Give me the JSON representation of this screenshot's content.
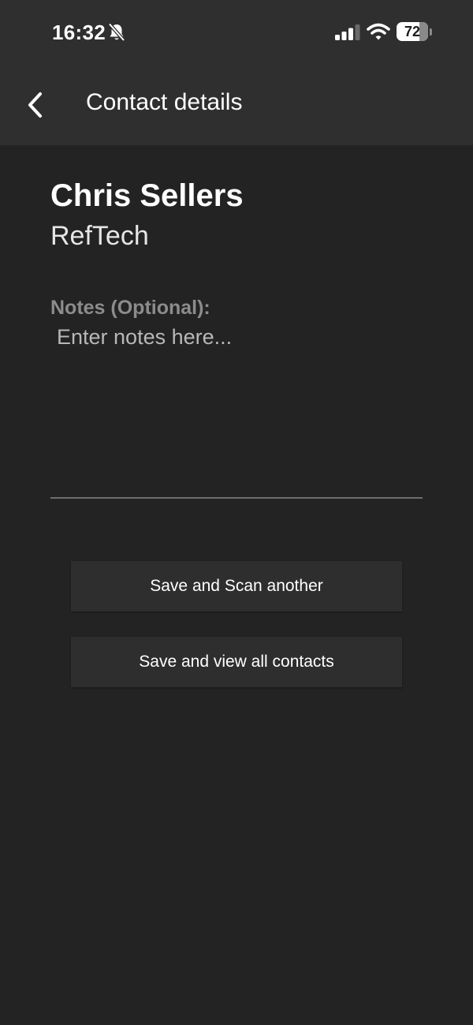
{
  "status_bar": {
    "time": "16:32",
    "battery_level": "72",
    "battery_fraction": 0.72,
    "icons": [
      "bell-slash-icon",
      "cellular-signal-icon",
      "wifi-icon",
      "battery-icon"
    ]
  },
  "header": {
    "back_icon": "chevron-left-icon",
    "title": "Contact details"
  },
  "contact": {
    "name": "Chris Sellers",
    "company": "RefTech"
  },
  "notes": {
    "label": "Notes (Optional):",
    "placeholder": "Enter notes here...",
    "value": ""
  },
  "actions": {
    "save_scan_label": "Save and Scan another",
    "save_view_label": "Save and view all contacts"
  },
  "colors": {
    "background": "#232323",
    "header_background": "#2f2f2f",
    "button_background": "#2e2e2e",
    "label_gray": "#8c8c8c",
    "divider": "#6e6e6e"
  }
}
